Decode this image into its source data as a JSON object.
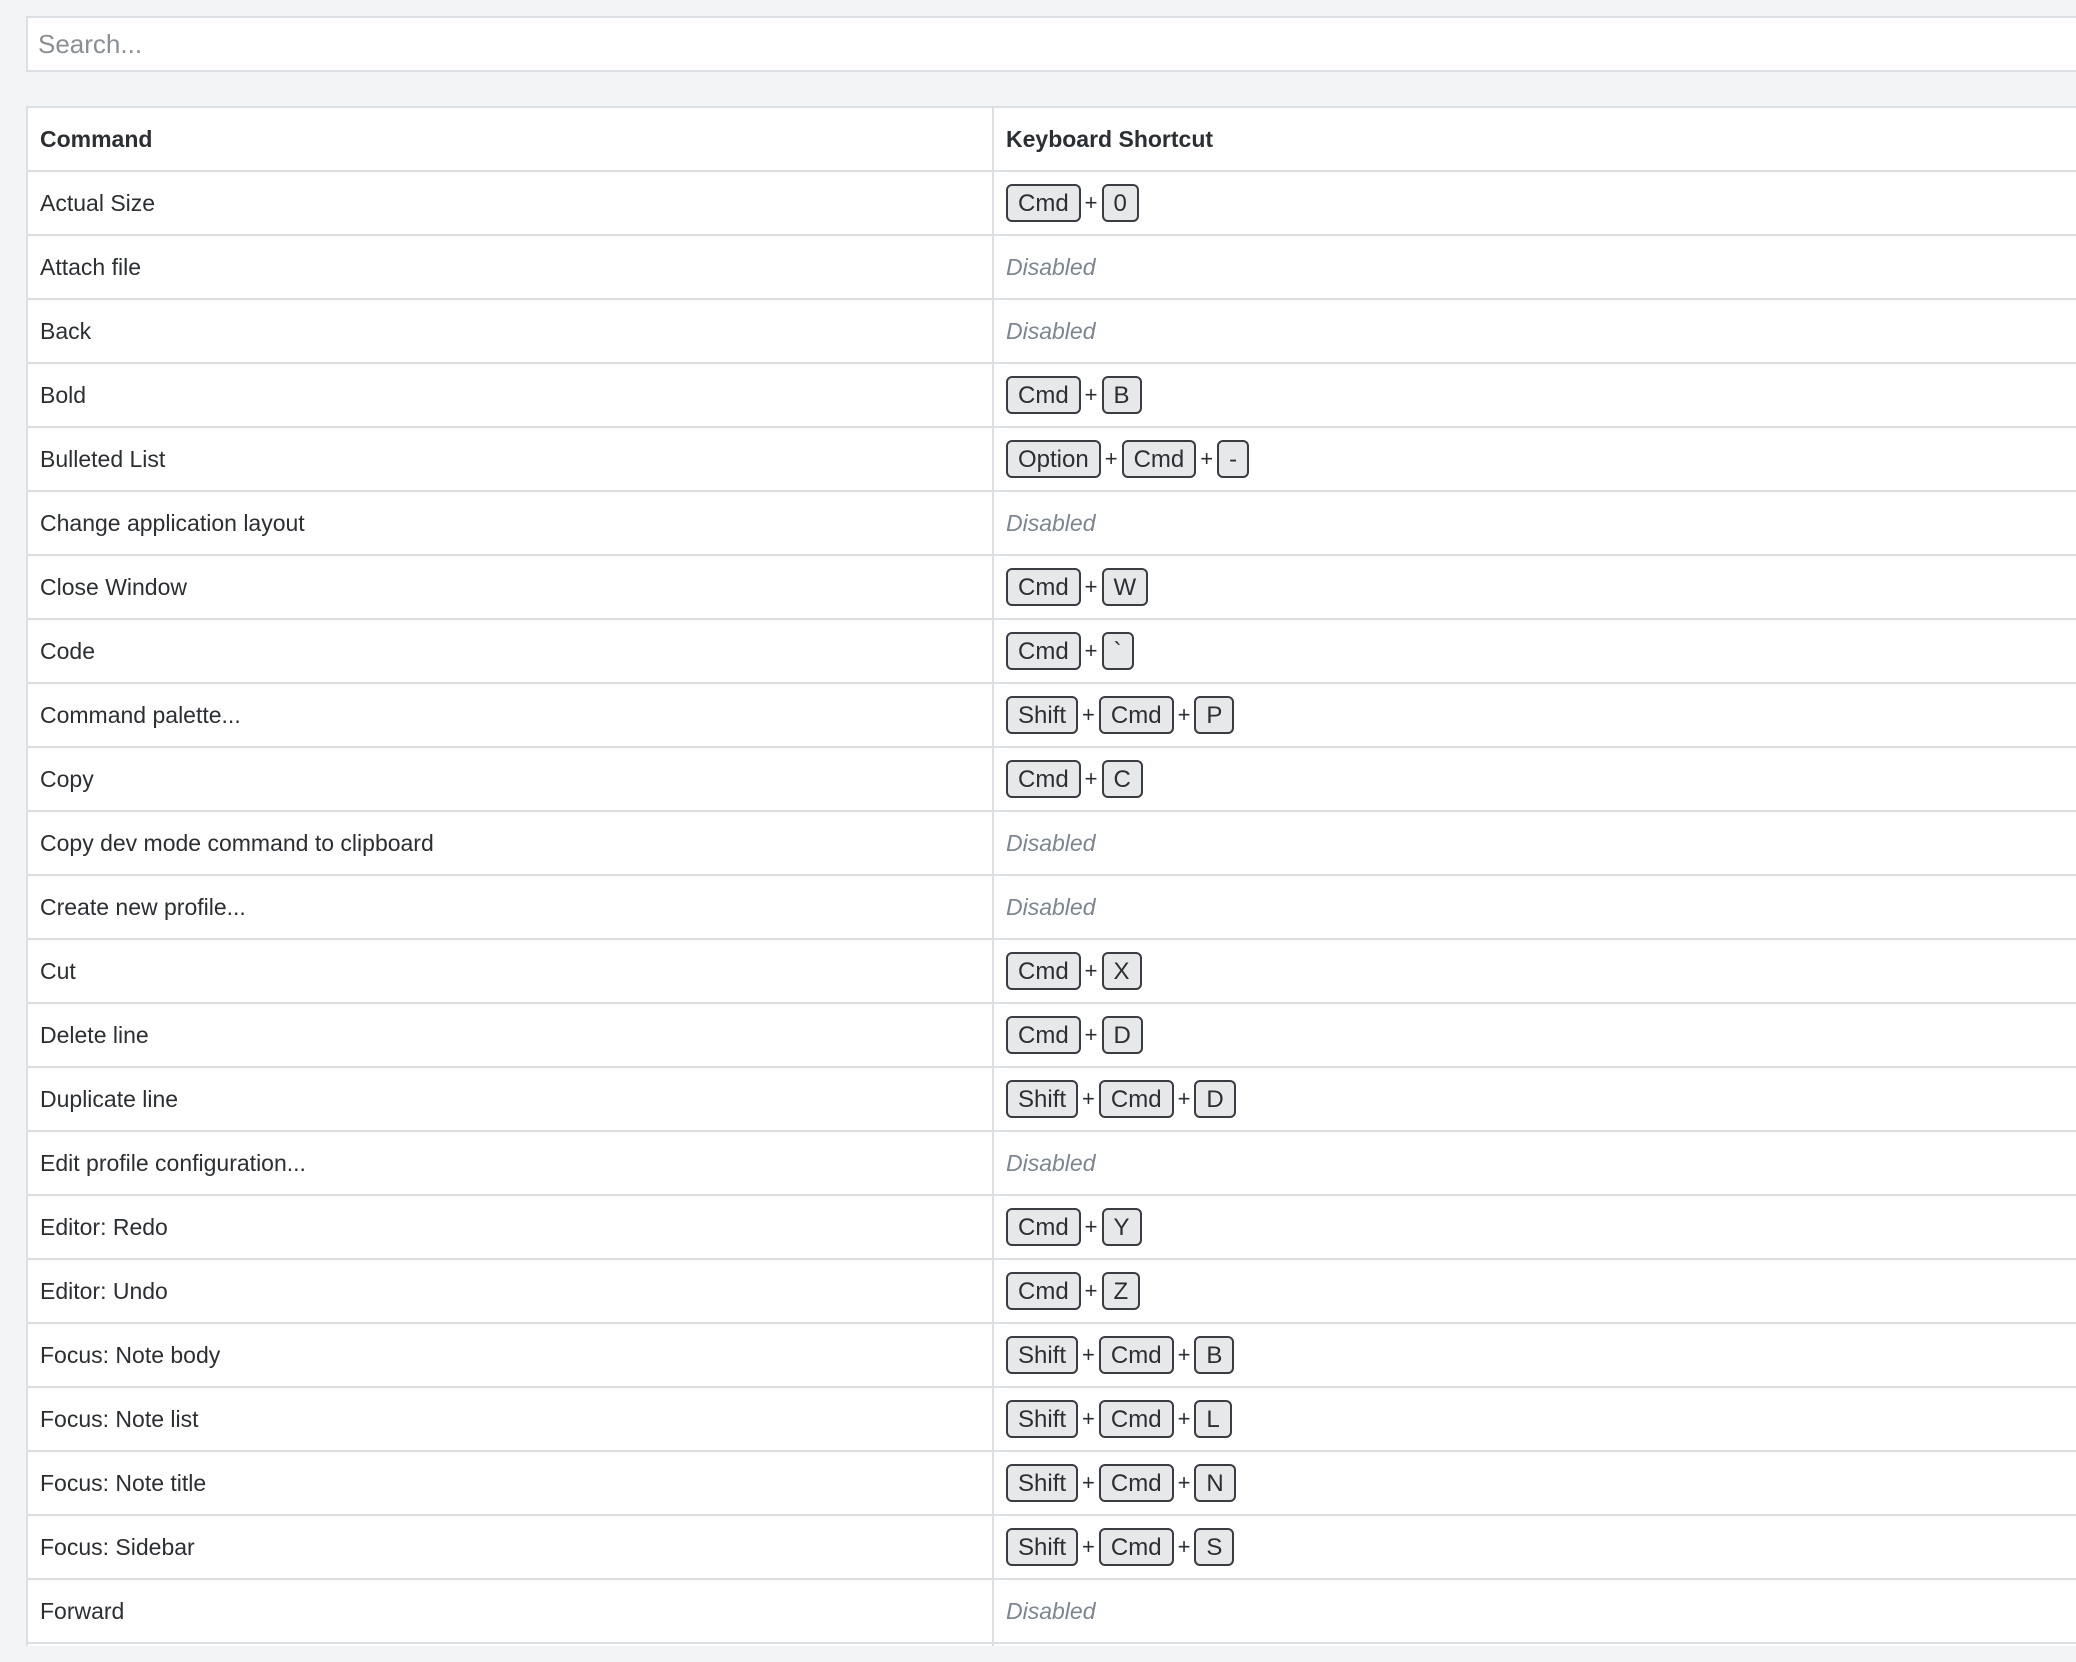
{
  "search": {
    "placeholder": "Search..."
  },
  "table": {
    "headers": {
      "command": "Command",
      "shortcut": "Keyboard Shortcut"
    },
    "disabled_label": "Disabled",
    "rows": [
      {
        "command": "Actual Size",
        "keys": [
          "Cmd",
          "0"
        ]
      },
      {
        "command": "Attach file",
        "keys": null
      },
      {
        "command": "Back",
        "keys": null
      },
      {
        "command": "Bold",
        "keys": [
          "Cmd",
          "B"
        ]
      },
      {
        "command": "Bulleted List",
        "keys": [
          "Option",
          "Cmd",
          "-"
        ]
      },
      {
        "command": "Change application layout",
        "keys": null
      },
      {
        "command": "Close Window",
        "keys": [
          "Cmd",
          "W"
        ]
      },
      {
        "command": "Code",
        "keys": [
          "Cmd",
          "`"
        ]
      },
      {
        "command": "Command palette...",
        "keys": [
          "Shift",
          "Cmd",
          "P"
        ]
      },
      {
        "command": "Copy",
        "keys": [
          "Cmd",
          "C"
        ]
      },
      {
        "command": "Copy dev mode command to clipboard",
        "keys": null
      },
      {
        "command": "Create new profile...",
        "keys": null
      },
      {
        "command": "Cut",
        "keys": [
          "Cmd",
          "X"
        ]
      },
      {
        "command": "Delete line",
        "keys": [
          "Cmd",
          "D"
        ]
      },
      {
        "command": "Duplicate line",
        "keys": [
          "Shift",
          "Cmd",
          "D"
        ]
      },
      {
        "command": "Edit profile configuration...",
        "keys": null
      },
      {
        "command": "Editor: Redo",
        "keys": [
          "Cmd",
          "Y"
        ]
      },
      {
        "command": "Editor: Undo",
        "keys": [
          "Cmd",
          "Z"
        ]
      },
      {
        "command": "Focus: Note body",
        "keys": [
          "Shift",
          "Cmd",
          "B"
        ]
      },
      {
        "command": "Focus: Note list",
        "keys": [
          "Shift",
          "Cmd",
          "L"
        ]
      },
      {
        "command": "Focus: Note title",
        "keys": [
          "Shift",
          "Cmd",
          "N"
        ]
      },
      {
        "command": "Focus: Sidebar",
        "keys": [
          "Shift",
          "Cmd",
          "S"
        ]
      },
      {
        "command": "Forward",
        "keys": null
      },
      {
        "command": "",
        "keys": null,
        "partial": true
      }
    ]
  }
}
